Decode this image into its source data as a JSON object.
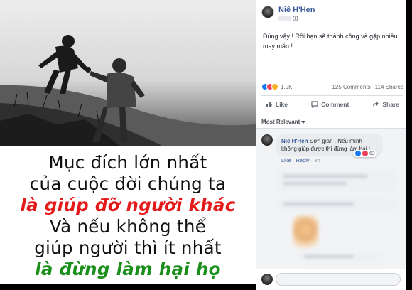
{
  "image": {
    "quote_lines": [
      {
        "text": "Mục đích lớn nhất",
        "style": "black"
      },
      {
        "text": "của cuộc đời chúng ta",
        "style": "black"
      },
      {
        "text": "là giúp đỡ người khác",
        "style": "red"
      },
      {
        "text": "Và nếu không thể",
        "style": "black"
      },
      {
        "text": "giúp người thì ít nhất",
        "style": "black"
      },
      {
        "text": "là đừng làm hại họ",
        "style": "green"
      }
    ]
  },
  "post": {
    "author": "Niê H'Hen",
    "avatar_icon": "profile-photo",
    "privacy_icon": "globe-icon",
    "text": "Đúng vậy ! Rồi bạn sẽ thành công và gặp nhiều may mắn !",
    "reactions": {
      "icons": [
        "like",
        "love",
        "haha"
      ],
      "count": "1.9K"
    },
    "comments_count": "125 Comments",
    "shares_count": "114 Shares"
  },
  "actions": {
    "like": "Like",
    "comment": "Comment",
    "share": "Share"
  },
  "comments_section": {
    "sort_label": "Most Relevant",
    "top_comment": {
      "author": "Niê H'Hen",
      "text": "Đơn giản . Nếu mình không giúp được thì đừng làm hại !",
      "reaction_count": "62",
      "like_label": "Like",
      "reply_label": "Reply",
      "time": "8h"
    }
  },
  "colors": {
    "link_blue": "#385898",
    "quote_red": "#e31b1b",
    "quote_green": "#1b8f1b"
  }
}
